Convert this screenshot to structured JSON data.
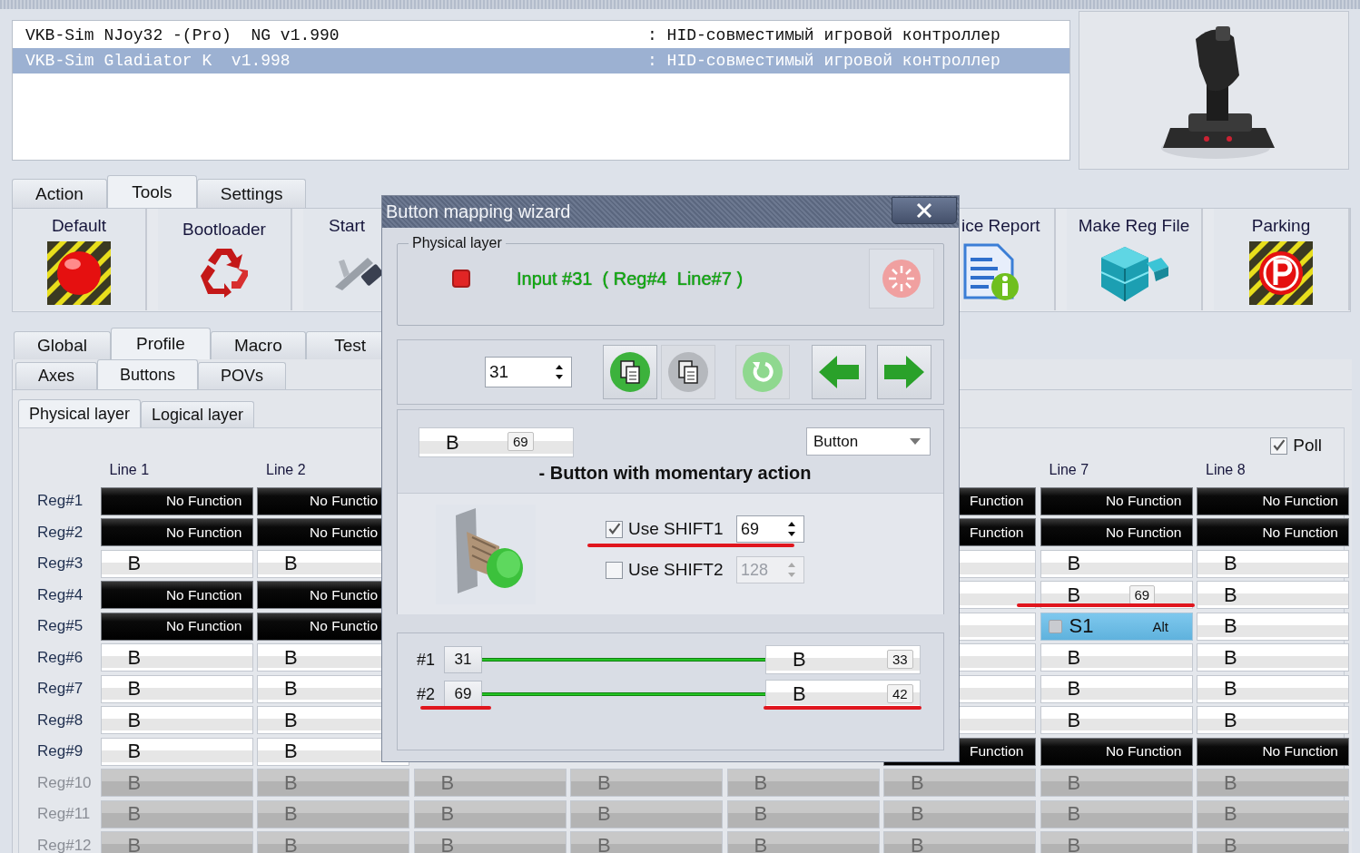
{
  "devices": [
    {
      "name": "VKB-Sim NJoy32 -(Pro)  NG v1.990",
      "type": ": HID-совместимый игровой контроллер",
      "selected": false
    },
    {
      "name": "VKB-Sim Gladiator K  v1.998",
      "type": ": HID-совместимый игровой контроллер",
      "selected": true
    }
  ],
  "main_tabs": [
    {
      "label": "Action",
      "selected": false
    },
    {
      "label": "Tools",
      "selected": true
    },
    {
      "label": "Settings",
      "selected": false
    }
  ],
  "toolbar_left": [
    {
      "label": "Default",
      "kind": "alarm"
    },
    {
      "label": "Bootloader",
      "kind": "recycle"
    },
    {
      "label": "Start",
      "kind": "caliper"
    }
  ],
  "toolbar_right": [
    {
      "label": "ice Report",
      "kind": "report"
    },
    {
      "label": "Make Reg File",
      "kind": "cubes"
    },
    {
      "label": "Parking",
      "kind": "parking"
    }
  ],
  "profile_tabs": [
    {
      "label": "Global",
      "selected": false
    },
    {
      "label": "Profile",
      "selected": true
    },
    {
      "label": "Macro",
      "selected": false
    },
    {
      "label": "Test",
      "selected": false
    }
  ],
  "section_tabs": [
    {
      "label": "Axes",
      "selected": false
    },
    {
      "label": "Buttons",
      "selected": true
    },
    {
      "label": "POVs",
      "selected": false
    }
  ],
  "layer_tabs": [
    {
      "label": "Physical layer",
      "selected": true
    },
    {
      "label": "Logical layer",
      "selected": false
    }
  ],
  "poll": {
    "label": "Poll",
    "checked": true
  },
  "grid": {
    "columns_left": [
      "Line 1",
      "Line 2"
    ],
    "columns_right": [
      "Line 7",
      "Line 8"
    ],
    "rows": [
      {
        "label": "Reg#1",
        "disabled": false,
        "cells": [
          {
            "kind": "none",
            "text": "No Function"
          },
          {
            "kind": "none",
            "text": "No Functio"
          },
          {
            "kind": "hidden"
          },
          {
            "kind": "hidden"
          },
          {
            "kind": "hidden"
          },
          {
            "kind": "none",
            "text": "Function"
          },
          {
            "kind": "none",
            "text": "No Function"
          },
          {
            "kind": "none",
            "text": "No Function"
          }
        ]
      },
      {
        "label": "Reg#2",
        "disabled": false,
        "cells": [
          {
            "kind": "none",
            "text": "No Function"
          },
          {
            "kind": "none",
            "text": "No Functio"
          },
          {
            "kind": "hidden"
          },
          {
            "kind": "hidden"
          },
          {
            "kind": "hidden"
          },
          {
            "kind": "none",
            "text": "Function"
          },
          {
            "kind": "none",
            "text": "No Function"
          },
          {
            "kind": "none",
            "text": "No Function"
          }
        ]
      },
      {
        "label": "Reg#3",
        "disabled": false,
        "cells": [
          {
            "kind": "button",
            "text": "B"
          },
          {
            "kind": "button",
            "text": "B"
          },
          {
            "kind": "hidden"
          },
          {
            "kind": "hidden"
          },
          {
            "kind": "hidden"
          },
          {
            "kind": "button"
          },
          {
            "kind": "button",
            "text": "B"
          },
          {
            "kind": "button",
            "text": "B"
          }
        ]
      },
      {
        "label": "Reg#4",
        "disabled": false,
        "cells": [
          {
            "kind": "none",
            "text": "No Function"
          },
          {
            "kind": "none",
            "text": "No Functio"
          },
          {
            "kind": "hidden"
          },
          {
            "kind": "hidden"
          },
          {
            "kind": "hidden"
          },
          {
            "kind": "button"
          },
          {
            "kind": "button",
            "text": "B",
            "badge": "69"
          },
          {
            "kind": "button",
            "text": "B"
          }
        ]
      },
      {
        "label": "Reg#5",
        "disabled": false,
        "cells": [
          {
            "kind": "none",
            "text": "No Function"
          },
          {
            "kind": "none",
            "text": "No Functio"
          },
          {
            "kind": "hidden"
          },
          {
            "kind": "hidden"
          },
          {
            "kind": "hidden"
          },
          {
            "kind": "button"
          },
          {
            "kind": "shift",
            "text": "S1",
            "badge": "Alt",
            "checked": false
          },
          {
            "kind": "button",
            "text": "B"
          }
        ]
      },
      {
        "label": "Reg#6",
        "disabled": false,
        "cells": [
          {
            "kind": "button",
            "text": "B"
          },
          {
            "kind": "button",
            "text": "B"
          },
          {
            "kind": "hidden"
          },
          {
            "kind": "hidden"
          },
          {
            "kind": "hidden"
          },
          {
            "kind": "button"
          },
          {
            "kind": "button",
            "text": "B"
          },
          {
            "kind": "button",
            "text": "B"
          }
        ]
      },
      {
        "label": "Reg#7",
        "disabled": false,
        "cells": [
          {
            "kind": "button",
            "text": "B"
          },
          {
            "kind": "button",
            "text": "B"
          },
          {
            "kind": "hidden"
          },
          {
            "kind": "hidden"
          },
          {
            "kind": "hidden"
          },
          {
            "kind": "button"
          },
          {
            "kind": "button",
            "text": "B"
          },
          {
            "kind": "button",
            "text": "B"
          }
        ]
      },
      {
        "label": "Reg#8",
        "disabled": false,
        "cells": [
          {
            "kind": "button",
            "text": "B"
          },
          {
            "kind": "button",
            "text": "B"
          },
          {
            "kind": "hidden"
          },
          {
            "kind": "hidden"
          },
          {
            "kind": "hidden"
          },
          {
            "kind": "button"
          },
          {
            "kind": "button",
            "text": "B"
          },
          {
            "kind": "button",
            "text": "B"
          }
        ]
      },
      {
        "label": "Reg#9",
        "disabled": false,
        "cells": [
          {
            "kind": "button",
            "text": "B"
          },
          {
            "kind": "button",
            "text": "B"
          },
          {
            "kind": "hidden"
          },
          {
            "kind": "hidden"
          },
          {
            "kind": "hidden"
          },
          {
            "kind": "none",
            "text": "Function"
          },
          {
            "kind": "none",
            "text": "No Function"
          },
          {
            "kind": "none",
            "text": "No Function"
          }
        ]
      },
      {
        "label": "Reg#10",
        "disabled": true,
        "cells": [
          {
            "kind": "button",
            "text": "B"
          },
          {
            "kind": "button",
            "text": "B"
          },
          {
            "kind": "button",
            "text": "B"
          },
          {
            "kind": "button",
            "text": "B"
          },
          {
            "kind": "button",
            "text": "B"
          },
          {
            "kind": "button",
            "text": "B"
          },
          {
            "kind": "button",
            "text": "B"
          },
          {
            "kind": "button",
            "text": "B"
          }
        ]
      },
      {
        "label": "Reg#11",
        "disabled": true,
        "cells": [
          {
            "kind": "button",
            "text": "B"
          },
          {
            "kind": "button",
            "text": "B"
          },
          {
            "kind": "button",
            "text": "B"
          },
          {
            "kind": "button",
            "text": "B"
          },
          {
            "kind": "button",
            "text": "B"
          },
          {
            "kind": "button",
            "text": "B"
          },
          {
            "kind": "button",
            "text": "B"
          },
          {
            "kind": "button",
            "text": "B"
          }
        ]
      },
      {
        "label": "Reg#12",
        "disabled": true,
        "cells": [
          {
            "kind": "button",
            "text": "B"
          },
          {
            "kind": "button",
            "text": "B"
          },
          {
            "kind": "button",
            "text": "B"
          },
          {
            "kind": "button",
            "text": "B"
          },
          {
            "kind": "button",
            "text": "B"
          },
          {
            "kind": "button",
            "text": "B"
          },
          {
            "kind": "button",
            "text": "B"
          },
          {
            "kind": "button",
            "text": "B"
          }
        ]
      }
    ]
  },
  "wizard": {
    "title": "Button mapping wizard",
    "group_label": "Physical layer",
    "indicator_on": true,
    "input_text": "Input #31  ( Reg#4  Line#7 )",
    "number": "31",
    "actions": [
      {
        "kind": "copy",
        "disabled": false
      },
      {
        "kind": "paste",
        "disabled": true
      },
      {
        "kind": "refresh",
        "disabled": true
      },
      {
        "kind": "back",
        "disabled": false
      },
      {
        "kind": "forward",
        "disabled": false
      }
    ],
    "mapping": {
      "label": "B",
      "badge": "69"
    },
    "type_select": "Button",
    "description": "- Button with momentary action",
    "shifts": [
      {
        "label": "Use SHIFT1",
        "checked": true,
        "value": "69",
        "disabled": false
      },
      {
        "label": "Use SHIFT2",
        "checked": false,
        "value": "128",
        "disabled": true
      }
    ],
    "chain": [
      {
        "label": "#1",
        "input": "31",
        "target": "B",
        "badge": "33"
      },
      {
        "label": "#2",
        "input": "69",
        "target": "B",
        "badge": "42"
      }
    ]
  }
}
